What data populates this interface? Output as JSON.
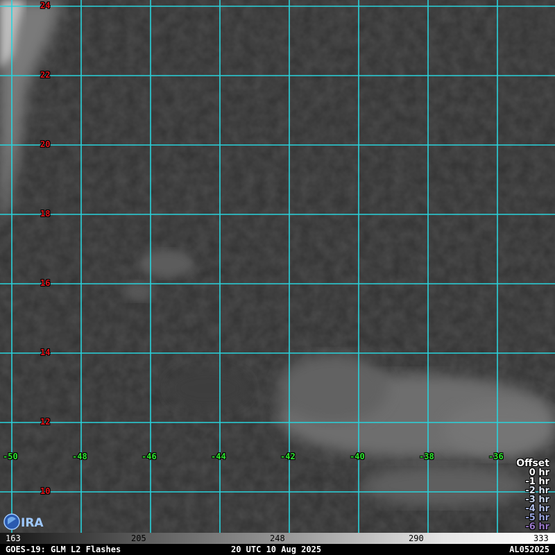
{
  "map": {
    "latitudes": [
      "24",
      "22",
      "20",
      "18",
      "16",
      "14",
      "12",
      "10"
    ],
    "longitudes": [
      "-50",
      "-48",
      "-46",
      "-44",
      "-42",
      "-40",
      "-38",
      "-36"
    ],
    "colors": {
      "grid": "#29d3dc",
      "lat_label": "#e0141a",
      "lon_label": "#2ee62e",
      "background": "#333333"
    }
  },
  "legend": {
    "title": "Offset",
    "items": [
      {
        "label": "0 hr",
        "color": "#ffffff"
      },
      {
        "label": "-1 hr",
        "color": "#ffffff"
      },
      {
        "label": "-2 hr",
        "color": "#dce4f0"
      },
      {
        "label": "-3 hr",
        "color": "#c8d4ec"
      },
      {
        "label": "-4 hr",
        "color": "#b0bde6"
      },
      {
        "label": "-5 hr",
        "color": "#9aa4de"
      },
      {
        "label": "-6 hr",
        "color": "#9a78c8"
      }
    ]
  },
  "colorbar": {
    "ticks": [
      "163",
      "205",
      "248",
      "290",
      "333"
    ]
  },
  "footer": {
    "left": "GOES-19: GLM L2 Flashes",
    "center": "20 UTC 10 Aug 2025",
    "right": "AL052025"
  },
  "logo_icon": "cira-logo"
}
